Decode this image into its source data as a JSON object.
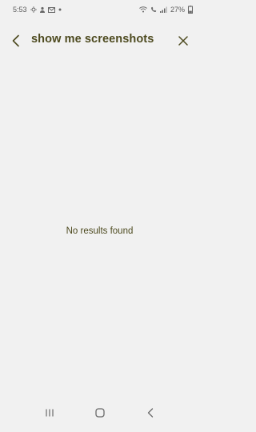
{
  "status_bar": {
    "time": "5:53",
    "battery": "27%",
    "notification_icons": [
      "weather-icon",
      "person-icon",
      "mail-icon",
      "dot-icon"
    ],
    "system_icons": [
      "wifi-icon",
      "call-icon",
      "signal-icon",
      "battery-icon"
    ]
  },
  "header": {
    "query": "show me screenshots"
  },
  "results": {
    "empty_message": "No results found"
  },
  "colors": {
    "background": "#f1f1f1",
    "text": "#4d4a1f",
    "status_text": "#5a5a5a"
  }
}
